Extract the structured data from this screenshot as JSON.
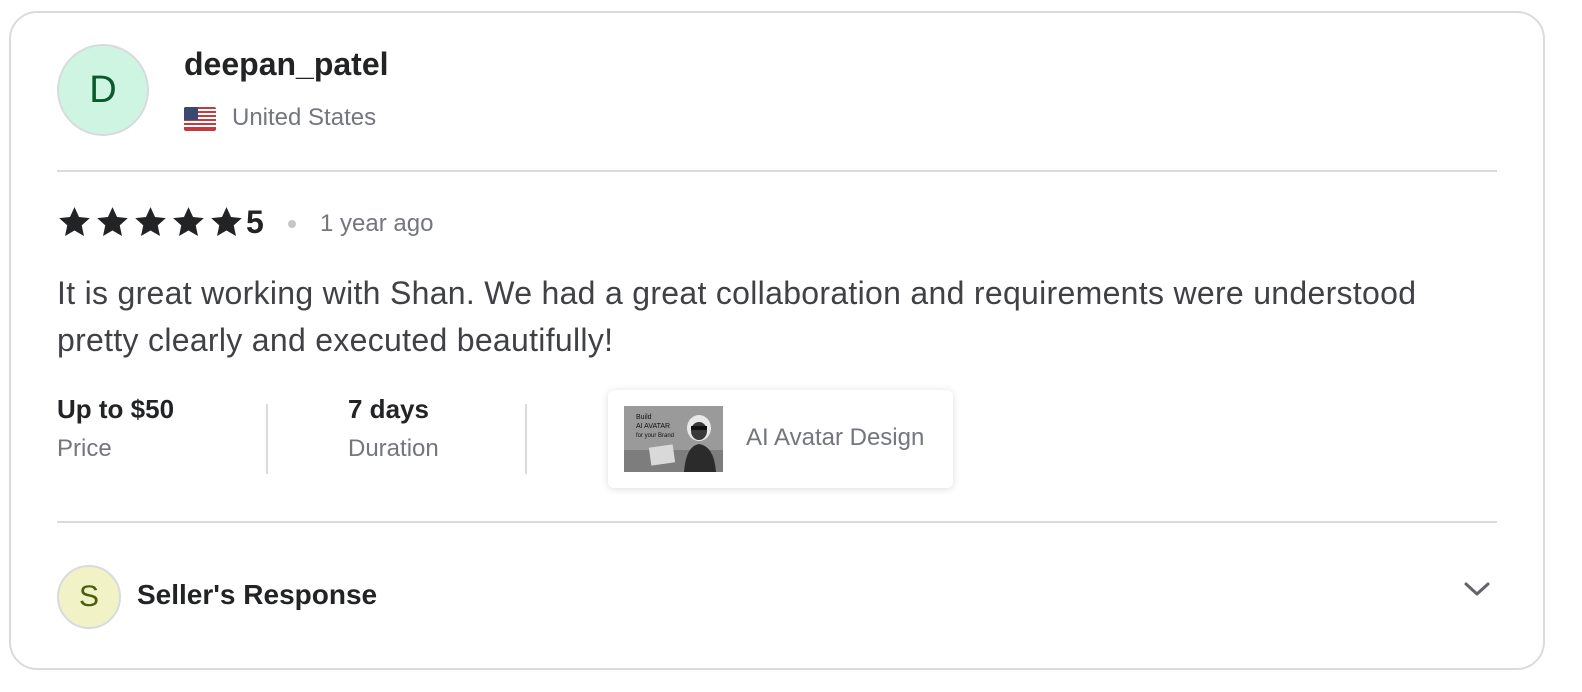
{
  "reviewer": {
    "avatar_initial": "D",
    "avatar_bg": "#cdf5e1",
    "username": "deepan_patel",
    "country": "United States",
    "flag_icon": "us-flag-icon"
  },
  "review": {
    "rating": "5",
    "star_count": 5,
    "time_ago": "1 year ago",
    "text": "It is great working with Shan. We had a great collaboration and requirements were understood pretty clearly and executed beautifully!"
  },
  "details": {
    "price_value": "Up to $50",
    "price_label": "Price",
    "duration_value": "7 days",
    "duration_label": "Duration"
  },
  "gig": {
    "title": "AI Avatar Design",
    "thumb_lines": [
      "Build",
      "AI AVATAR",
      "for your Brand"
    ]
  },
  "seller_response": {
    "avatar_initial": "S",
    "avatar_bg": "#f1f3c7",
    "label": "Seller's Response",
    "toggle_icon": "chevron-down-icon"
  }
}
